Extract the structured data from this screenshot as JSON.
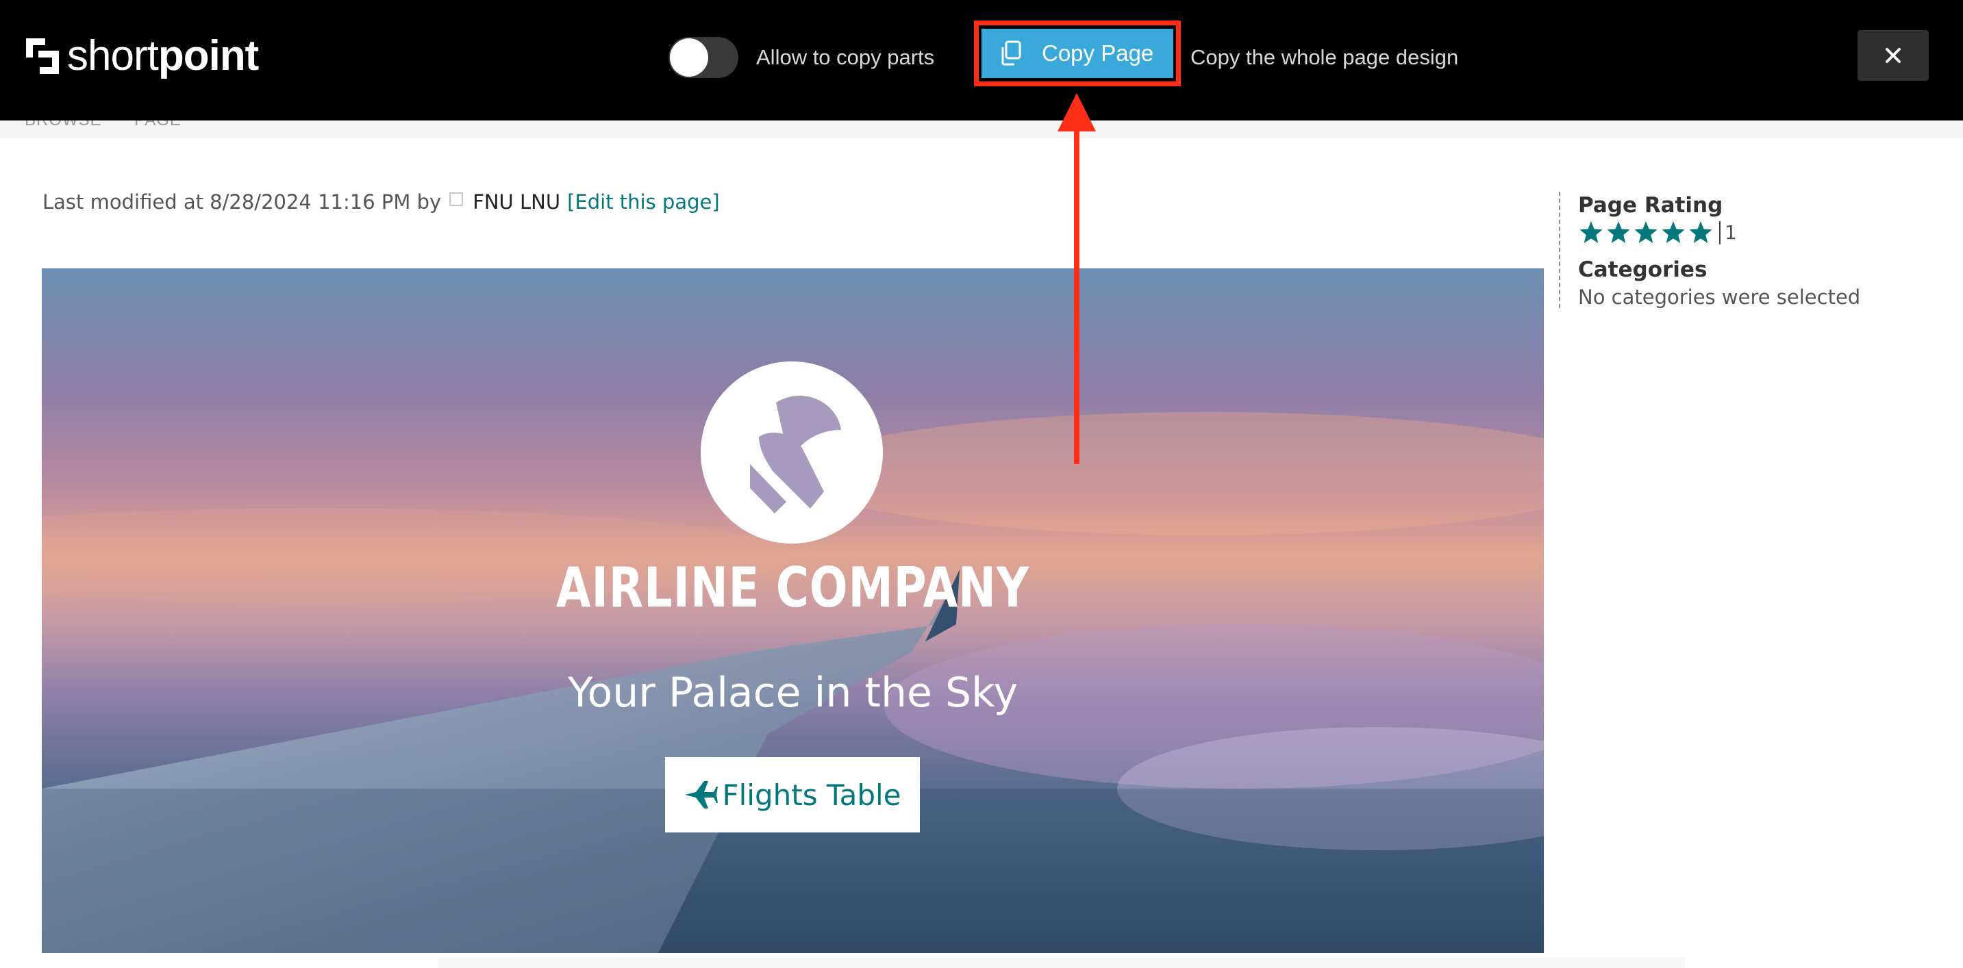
{
  "toolbar": {
    "logo_light": "short",
    "logo_bold": "point",
    "allow_copy_label": "Allow to copy parts",
    "allow_copy_enabled": false,
    "copy_button_label": "Copy Page",
    "copy_description": "Copy the whole page design",
    "close_label": "×"
  },
  "ribbon": {
    "items": [
      "BROWSE",
      "PAGE"
    ]
  },
  "page_meta": {
    "prefix": "Last modified at 8/28/2024 11:16 PM by",
    "author": "FNU LNU",
    "edit_link": "[Edit this page]"
  },
  "banner": {
    "company_name": "AIRLINE COMPANY",
    "tagline": "Your Palace in the Sky",
    "button_label": "Flights Table"
  },
  "sidebar": {
    "rating_heading": "Page Rating",
    "rating_stars": 5,
    "rating_count": "1",
    "categories_heading": "Categories",
    "categories_text": "No categories were selected"
  },
  "colors": {
    "toolbar_bg": "#000000",
    "copy_button": "#3aa8d8",
    "highlight": "#ff2d14",
    "link_teal": "#03787c"
  }
}
